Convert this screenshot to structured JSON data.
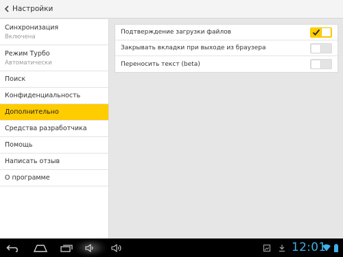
{
  "header": {
    "title": "Настройки",
    "back_icon": "chevron-left-icon"
  },
  "sidebar": {
    "items": [
      {
        "label": "Синхронизация",
        "sub": "Включена",
        "active": false
      },
      {
        "label": "Режим Турбо",
        "sub": "Автоматически",
        "active": false
      },
      {
        "label": "Поиск",
        "active": false
      },
      {
        "label": "Конфиденциальность",
        "active": false
      },
      {
        "label": "Дополнительно",
        "active": true
      },
      {
        "label": "Средства разработчика",
        "active": false
      },
      {
        "label": "Помощь",
        "active": false
      },
      {
        "label": "Написать отзыв",
        "active": false
      },
      {
        "label": "О программе",
        "active": false
      }
    ]
  },
  "settings": {
    "rows": [
      {
        "label": "Подтверждение загрузки файлов",
        "enabled": true
      },
      {
        "label": "Закрывать вкладки при выходе из браузера",
        "enabled": false
      },
      {
        "label": "Переносить текст (beta)",
        "enabled": false
      }
    ]
  },
  "statusbar": {
    "time": "12:01",
    "icons": [
      "back-icon",
      "home-icon",
      "recent-apps-icon",
      "volume-down-icon",
      "volume-up-icon",
      "screenshot-icon",
      "download-icon",
      "wifi-icon",
      "battery-icon"
    ]
  },
  "colors": {
    "accent": "#ffcc00",
    "clock": "#3fb0e8",
    "navbar": "#000000"
  }
}
